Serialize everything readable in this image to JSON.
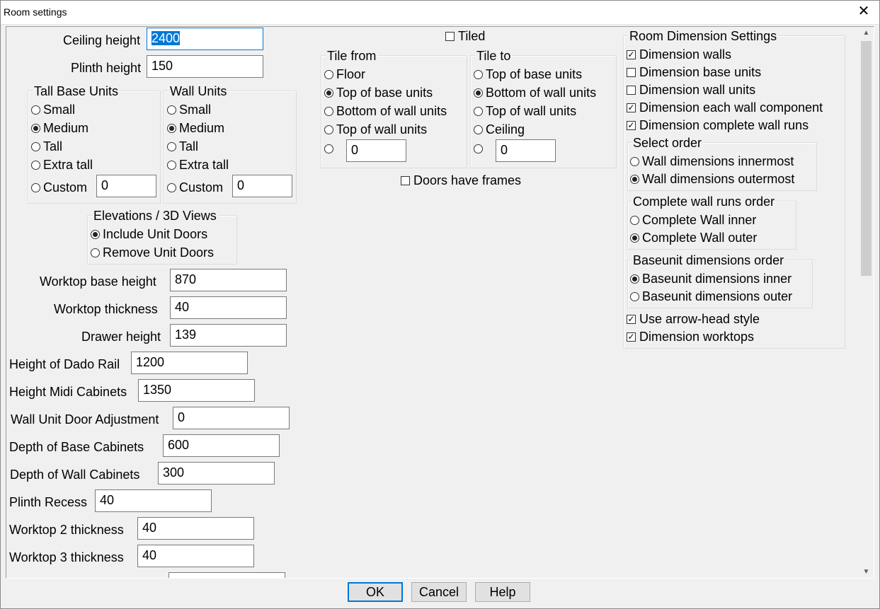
{
  "window": {
    "title": "Room settings",
    "close_glyph": "✕"
  },
  "fields": [
    {
      "label": "Ceiling height",
      "value": "2400"
    },
    {
      "label": "Plinth height",
      "value": "150"
    },
    {
      "label": "Worktop base height",
      "value": "870"
    },
    {
      "label": "Worktop thickness",
      "value": "40"
    },
    {
      "label": "Drawer height",
      "value": "139"
    },
    {
      "label": "Height of Dado Rail",
      "value": "1200"
    },
    {
      "label": "Height Midi Cabinets",
      "value": "1350"
    },
    {
      "label": "Wall Unit Door Adjustment",
      "value": "0"
    },
    {
      "label": "Depth of Base Cabinets",
      "value": "600"
    },
    {
      "label": "Depth of Wall Cabinets",
      "value": "300"
    },
    {
      "label": "Plinth Recess",
      "value": "40"
    },
    {
      "label": "Worktop 2 thickness",
      "value": "40"
    },
    {
      "label": "Worktop 3 thickness",
      "value": "40"
    }
  ],
  "tall_base_units": {
    "title": "Tall Base Units",
    "options": [
      "Small",
      "Medium",
      "Tall",
      "Extra tall",
      "Custom"
    ],
    "selected": "Medium",
    "custom_value": "0"
  },
  "wall_units": {
    "title": "Wall Units",
    "options": [
      "Small",
      "Medium",
      "Tall",
      "Extra tall",
      "Custom"
    ],
    "selected": "Medium",
    "custom_value": "0"
  },
  "elevations": {
    "title": "Elevations / 3D Views",
    "options": [
      "Include Unit Doors",
      "Remove Unit Doors"
    ],
    "selected": "Include Unit Doors"
  },
  "tiled": {
    "label": "Tiled",
    "checked": false
  },
  "tile_from": {
    "title": "Tile from",
    "options": [
      "Floor",
      "Top of base units",
      "Bottom of wall units",
      "Top of wall units"
    ],
    "selected": "Top of base units",
    "custom_value": "0"
  },
  "tile_to": {
    "title": "Tile to",
    "options": [
      "Top of base units",
      "Bottom of wall units",
      "Top of wall units",
      "Ceiling"
    ],
    "selected": "Bottom of wall units",
    "custom_value": "0"
  },
  "doors_have_frames": {
    "label": "Doors have frames",
    "checked": false
  },
  "room_dimension": {
    "title": "Room Dimension Settings",
    "checks": [
      {
        "label": "Dimension walls",
        "checked": true
      },
      {
        "label": "Dimension base units",
        "checked": false
      },
      {
        "label": "Dimension wall units",
        "checked": false
      },
      {
        "label": "Dimension each wall component",
        "checked": true
      },
      {
        "label": "Dimension complete wall runs",
        "checked": true
      }
    ],
    "select_order": {
      "title": "Select order",
      "options": [
        "Wall dimensions innermost",
        "Wall dimensions outermost"
      ],
      "selected": "Wall dimensions outermost"
    },
    "complete_wall_runs_order": {
      "title": "Complete wall runs order",
      "options": [
        "Complete Wall inner",
        "Complete Wall outer"
      ],
      "selected": "Complete Wall outer"
    },
    "baseunit_order": {
      "title": "Baseunit dimensions order",
      "options": [
        "Baseunit dimensions inner",
        "Baseunit dimensions outer"
      ],
      "selected": "Baseunit dimensions inner"
    },
    "extra_checks": [
      {
        "label": "Use arrow-head style",
        "checked": true
      },
      {
        "label": "Dimension worktops",
        "checked": true
      }
    ]
  },
  "buttons": {
    "ok": "OK",
    "cancel": "Cancel",
    "help": "Help"
  },
  "check_glyph": "✓"
}
